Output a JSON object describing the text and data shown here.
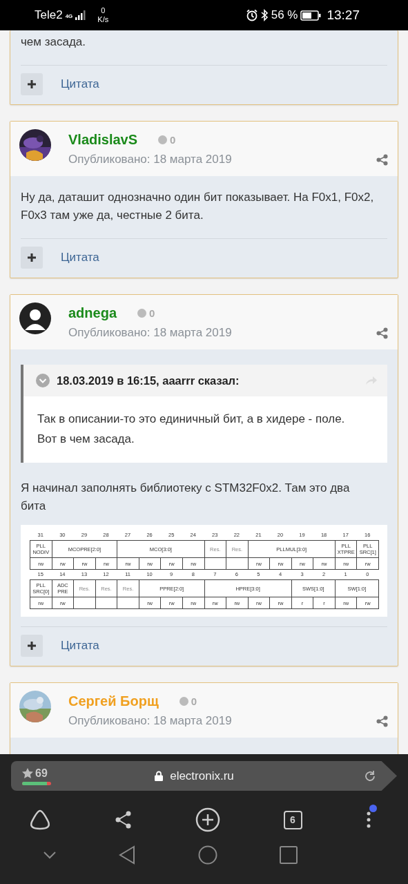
{
  "status_bar": {
    "carrier": "Tele2",
    "network": "4G",
    "speed_value": "0",
    "speed_unit": "K/s",
    "battery": "56 %",
    "time": "13:27"
  },
  "posts": [
    {
      "paragraphs": [
        "чем засада."
      ],
      "quote_button": "Цитата"
    },
    {
      "author": "VladislavS",
      "color": "#1a8a1a",
      "avatar": {
        "kind": "picture"
      },
      "reputation": "0",
      "date": "Опубликовано: 18 марта 2019",
      "paragraphs": [
        "Ну да, даташит однозначно один бит показывает. На F0x1, F0x2, F0x3 там уже да, честные 2 бита."
      ],
      "quote_button": "Цитата"
    },
    {
      "author": "adnega",
      "color": "#1a8a1a",
      "avatar": {
        "kind": "default"
      },
      "reputation": "0",
      "date": "Опубликовано: 18 марта 2019",
      "quote": {
        "header": "18.03.2019 в 16:15, aaarrr сказал:",
        "text": "Так в описании-то это единичный бит, а в хидере - поле. Вот в чем засада."
      },
      "paragraphs": [
        "Я начинал заполнять библиотеку с STM32F0x2. Там это два бита"
      ],
      "register_table": {
        "halves": [
          [
            {
              "name": "PLL NODIV",
              "reserved": false,
              "bits": [
                {
                  "number": "31",
                  "access": "rw"
                }
              ]
            },
            {
              "name": "MCOPRE[2:0]",
              "reserved": false,
              "bits": [
                {
                  "number": "30",
                  "access": "rw"
                },
                {
                  "number": "29",
                  "access": "rw"
                },
                {
                  "number": "28",
                  "access": "rw"
                }
              ]
            },
            {
              "name": "MCO[3:0]",
              "reserved": false,
              "bits": [
                {
                  "number": "27",
                  "access": "rw"
                },
                {
                  "number": "26",
                  "access": "rw"
                },
                {
                  "number": "25",
                  "access": "rw"
                },
                {
                  "number": "24",
                  "access": "rw"
                }
              ]
            },
            {
              "name": "Res.",
              "reserved": true,
              "bits": [
                {
                  "number": "23"
                }
              ]
            },
            {
              "name": "Res.",
              "reserved": true,
              "bits": [
                {
                  "number": "22"
                }
              ]
            },
            {
              "name": "PLLMUL[3:0]",
              "reserved": false,
              "bits": [
                {
                  "number": "21",
                  "access": "rw"
                },
                {
                  "number": "20",
                  "access": "rw"
                },
                {
                  "number": "19",
                  "access": "rw"
                },
                {
                  "number": "18",
                  "access": "rw"
                }
              ]
            },
            {
              "name": "PLL XTPRE",
              "reserved": false,
              "bits": [
                {
                  "number": "17",
                  "access": "rw"
                }
              ]
            },
            {
              "name": "PLL SRC[1]",
              "reserved": false,
              "bits": [
                {
                  "number": "16",
                  "access": "rw"
                }
              ]
            }
          ],
          [
            {
              "name": "PLL SRC[0]",
              "reserved": false,
              "bits": [
                {
                  "number": "15",
                  "access": "rw"
                }
              ]
            },
            {
              "name": "ADC PRE",
              "reserved": false,
              "bits": [
                {
                  "number": "14",
                  "access": "rw"
                }
              ]
            },
            {
              "name": "Res.",
              "reserved": true,
              "bits": [
                {
                  "number": "13"
                }
              ]
            },
            {
              "name": "Res.",
              "reserved": true,
              "bits": [
                {
                  "number": "12"
                }
              ]
            },
            {
              "name": "Res.",
              "reserved": true,
              "bits": [
                {
                  "number": "11"
                }
              ]
            },
            {
              "name": "PPRE[2:0]",
              "reserved": false,
              "bits": [
                {
                  "number": "10",
                  "access": "rw"
                },
                {
                  "number": "9",
                  "access": "rw"
                },
                {
                  "number": "8",
                  "access": "rw"
                }
              ]
            },
            {
              "name": "HPRE[3:0]",
              "reserved": false,
              "bits": [
                {
                  "number": "7",
                  "access": "rw"
                },
                {
                  "number": "6",
                  "access": "rw"
                },
                {
                  "number": "5",
                  "access": "rw"
                },
                {
                  "number": "4",
                  "access": "rw"
                }
              ]
            },
            {
              "name": "SWS[1:0]",
              "reserved": false,
              "bits": [
                {
                  "number": "3",
                  "access": "r"
                },
                {
                  "number": "2",
                  "access": "r"
                }
              ]
            },
            {
              "name": "SW[1:0]",
              "reserved": false,
              "bits": [
                {
                  "number": "1",
                  "access": "rw"
                },
                {
                  "number": "0",
                  "access": "rw"
                }
              ]
            }
          ]
        ]
      },
      "quote_button": "Цитата"
    },
    {
      "author": "Сергей Борщ",
      "color": "#f0a020",
      "avatar": {
        "kind": "picture"
      },
      "reputation": "0",
      "date": "Опубликовано: 18 марта 2019"
    }
  ],
  "browser": {
    "rating": "69",
    "level": 0.85,
    "url": "electronix.ru",
    "tab_count": "6",
    "menu_notification": true
  }
}
